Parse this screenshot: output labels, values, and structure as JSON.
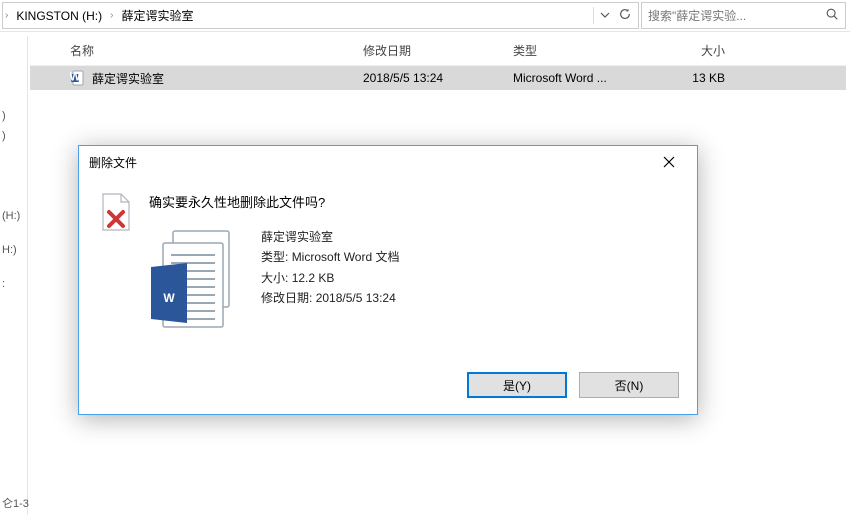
{
  "breadcrumb": {
    "drive": "KINGSTON (H:)",
    "folder": "薛定谔实验室"
  },
  "search": {
    "placeholder": "搜索\"薛定谔实验..."
  },
  "columns": {
    "name": "名称",
    "date": "修改日期",
    "type": "类型",
    "size": "大小"
  },
  "rows": [
    {
      "name": "薛定谔实验室",
      "date": "2018/5/5 13:24",
      "type": "Microsoft Word ...",
      "size": "13 KB"
    }
  ],
  "sidebar": {
    "frag1": ")",
    "frag2": "(H:)",
    "frag3": "H:)",
    "frag4": ":"
  },
  "bottom": {
    "frag": "仑1-3"
  },
  "dialog": {
    "title": "删除文件",
    "question": "确实要永久性地删除此文件吗?",
    "file": {
      "name": "薛定谔实验室",
      "type_label": "类型:",
      "type": "Microsoft Word 文档",
      "size_label": "大小:",
      "size": "12.2 KB",
      "date_label": "修改日期:",
      "date": "2018/5/5 13:24"
    },
    "yes": "是(Y)",
    "no": "否(N)"
  }
}
